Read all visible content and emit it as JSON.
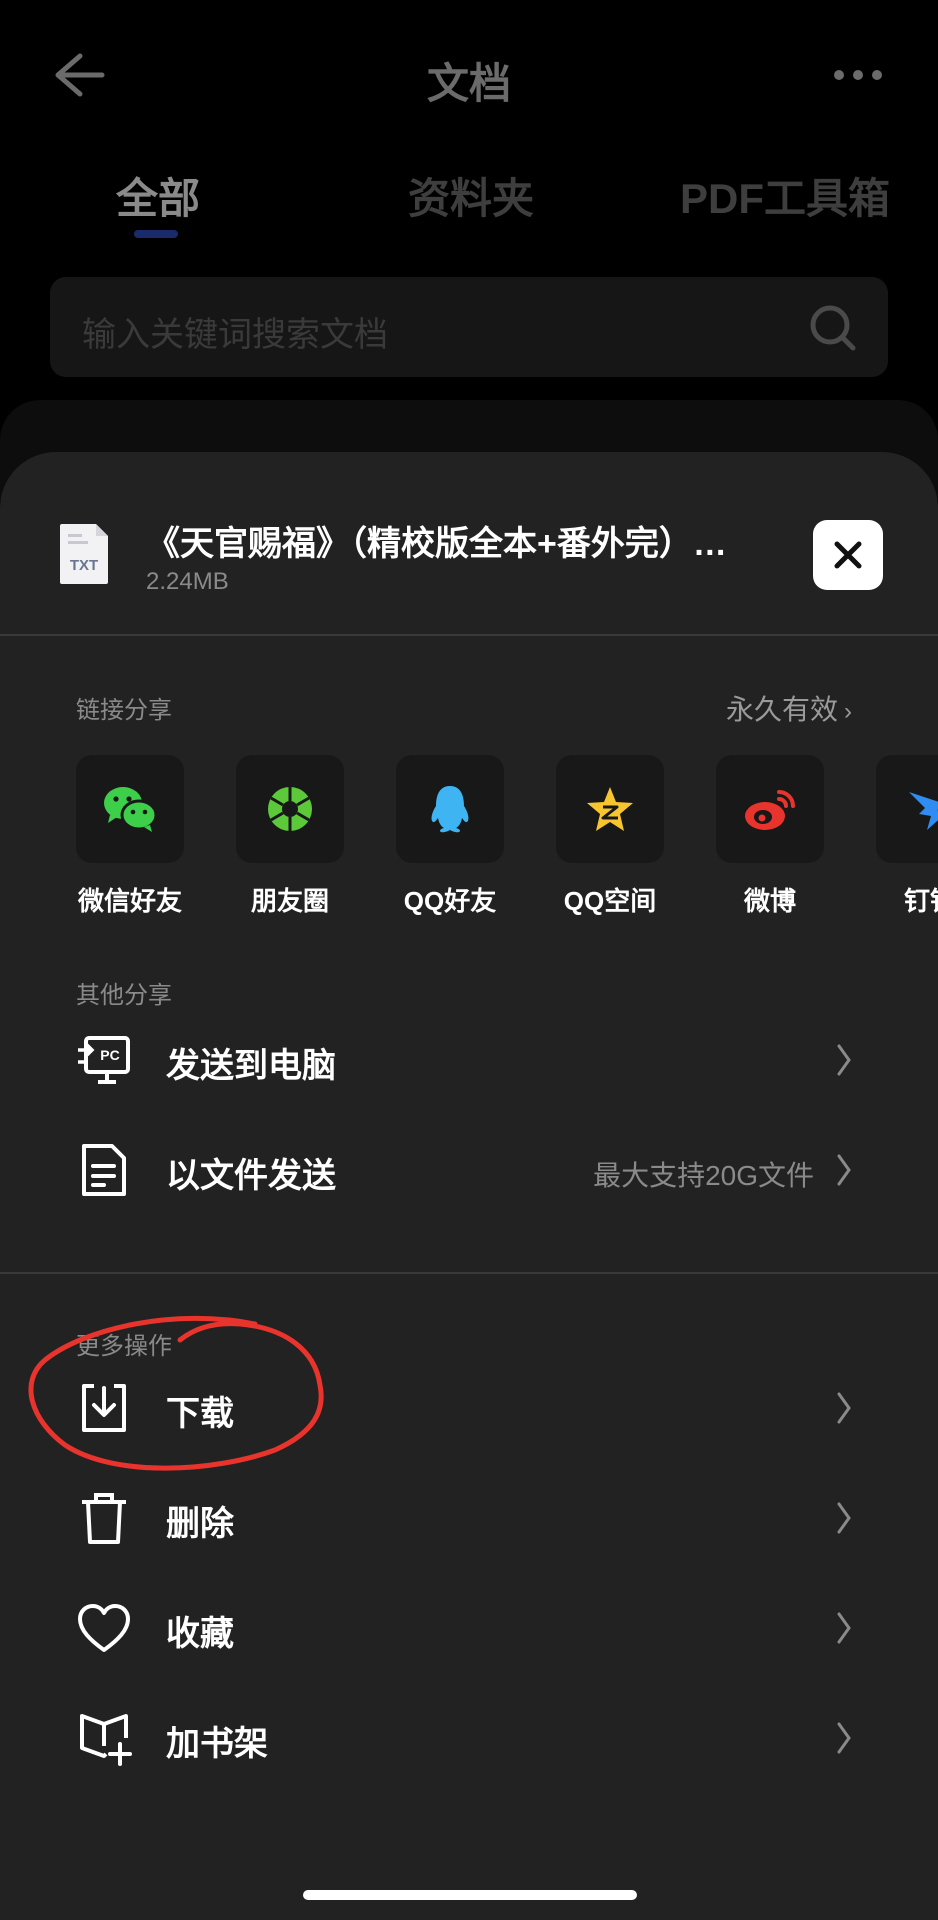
{
  "header": {
    "title": "文档",
    "tabs": [
      {
        "label": "全部",
        "active": true
      },
      {
        "label": "资料夹",
        "active": false
      },
      {
        "label": "PDF工具箱",
        "active": false
      }
    ],
    "search_placeholder": "输入关键词搜索文档"
  },
  "sheet": {
    "file": {
      "icon_label": "TXT",
      "name": "《天官赐福》（精校版全本+番外完）…",
      "size": "2.24MB"
    },
    "link_share": {
      "label": "链接分享",
      "validity": "永久有效",
      "items": [
        {
          "label": "微信好友",
          "icon": "wechat-icon"
        },
        {
          "label": "朋友圈",
          "icon": "moments-icon"
        },
        {
          "label": "QQ好友",
          "icon": "qq-icon"
        },
        {
          "label": "QQ空间",
          "icon": "qzone-icon"
        },
        {
          "label": "微博",
          "icon": "weibo-icon"
        },
        {
          "label": "钉钉",
          "icon": "dingtalk-icon"
        }
      ]
    },
    "other_share": {
      "label": "其他分享",
      "items": [
        {
          "label": "发送到电脑",
          "hint": ""
        },
        {
          "label": "以文件发送",
          "hint": "最大支持20G文件"
        }
      ]
    },
    "more_actions": {
      "label": "更多操作",
      "items": [
        {
          "label": "下载"
        },
        {
          "label": "删除"
        },
        {
          "label": "收藏"
        },
        {
          "label": "加书架"
        }
      ]
    }
  },
  "colors": {
    "sheet_bg": "#222222",
    "annotation": "#e8342c",
    "tab_indicator": "#1a2a6a"
  }
}
